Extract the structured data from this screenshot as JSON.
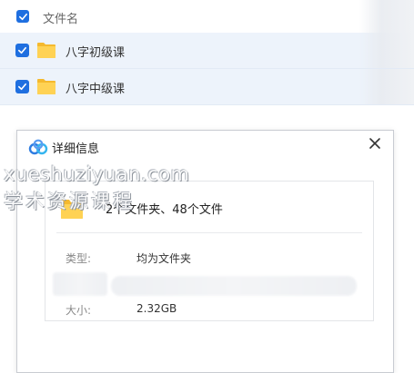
{
  "file_list": {
    "header": {
      "column_name": "文件名",
      "select_all_checked": true
    },
    "rows": [
      {
        "name": "八字初级课",
        "type": "folder",
        "checked": true
      },
      {
        "name": "八字中级课",
        "type": "folder",
        "checked": true
      }
    ]
  },
  "dialog": {
    "title": "详细信息",
    "logo_icon": "baidu-netdisk-logo-icon",
    "close_icon": "close-icon",
    "summary": "2个文件夹、48个文件",
    "properties": {
      "type_label": "类型:",
      "type_value": "均为文件夹",
      "size_label": "大小:",
      "size_value": "2.32GB"
    }
  },
  "watermark": {
    "line1": "xueshuziyuan.com",
    "line2": "学术资源课程"
  },
  "colors": {
    "accent": "#1f6fe0",
    "selected_row": "#edf3fb",
    "folder_yellow": "#f7c744"
  }
}
